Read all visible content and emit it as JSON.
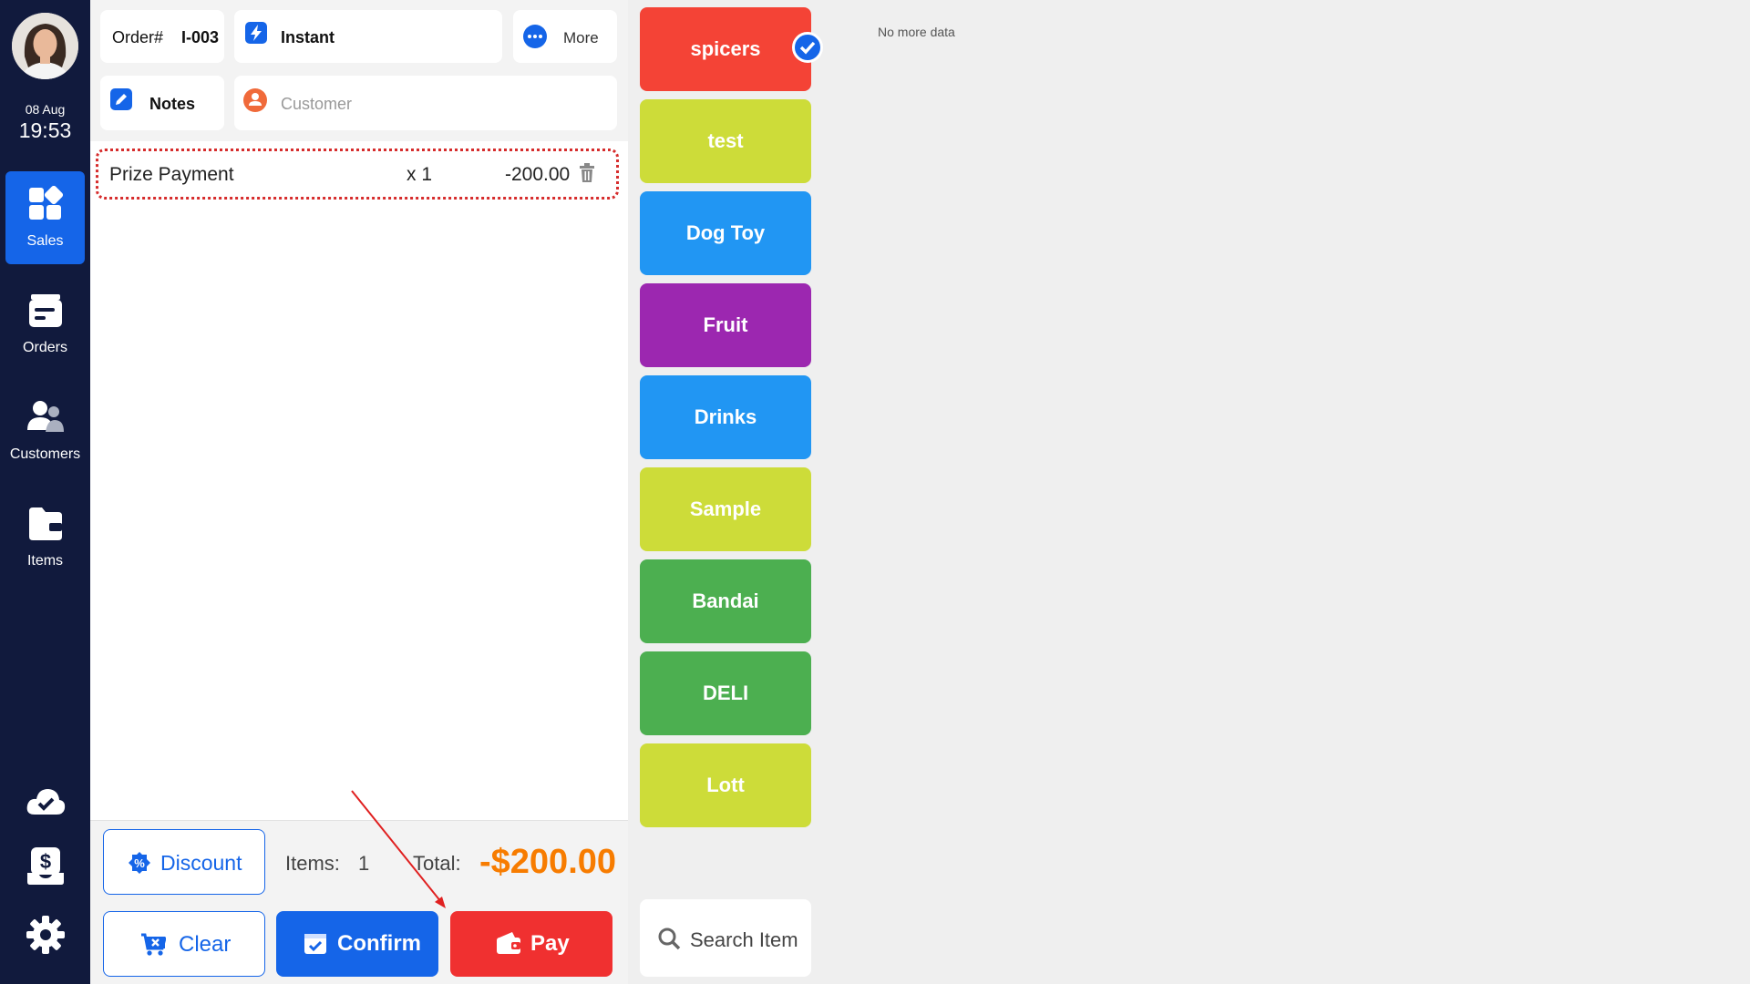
{
  "sidebar": {
    "date": "08 Aug",
    "time": "19:53",
    "nav": [
      {
        "label": "Sales",
        "icon": "sales-grid-icon",
        "active": true
      },
      {
        "label": "Orders",
        "icon": "orders-icon"
      },
      {
        "label": "Customers",
        "icon": "customers-icon"
      },
      {
        "label": "Items",
        "icon": "items-folder-icon"
      }
    ],
    "bottom_icons": [
      "cloud-check-icon",
      "cash-register-icon",
      "gear-icon"
    ]
  },
  "header": {
    "order_prefix": "Order#",
    "order_number": "I-003",
    "instant_label": "Instant",
    "more_label": "More",
    "notes_label": "Notes",
    "customer_placeholder": "Customer"
  },
  "order_items": [
    {
      "name": "Prize Payment",
      "qty": "x 1",
      "amount": "-200.00"
    }
  ],
  "summary": {
    "discount_label": "Discount",
    "items_label": "Items:",
    "items_count": "1",
    "total_label": "Total:",
    "total_value": "-$200.00"
  },
  "actions": {
    "clear_label": "Clear",
    "confirm_label": "Confirm",
    "pay_label": "Pay"
  },
  "categories": [
    {
      "label": "spicers",
      "color": "#f44336",
      "selected": true
    },
    {
      "label": "test",
      "color": "#cddc39"
    },
    {
      "label": "Dog Toy",
      "color": "#2196f3"
    },
    {
      "label": "Fruit",
      "color": "#9c27b0"
    },
    {
      "label": "Drinks",
      "color": "#2196f3"
    },
    {
      "label": "Sample",
      "color": "#cddc39"
    },
    {
      "label": "Bandai",
      "color": "#4caf50"
    },
    {
      "label": "DELI",
      "color": "#4caf50"
    },
    {
      "label": "Lott",
      "color": "#cddc39"
    }
  ],
  "search": {
    "placeholder": "Search Item"
  },
  "content": {
    "no_more_data": "No more data"
  },
  "colors": {
    "primary": "#1565e8",
    "danger": "#f03030",
    "sidebar": "#111a3d",
    "total": "#f77c00"
  }
}
